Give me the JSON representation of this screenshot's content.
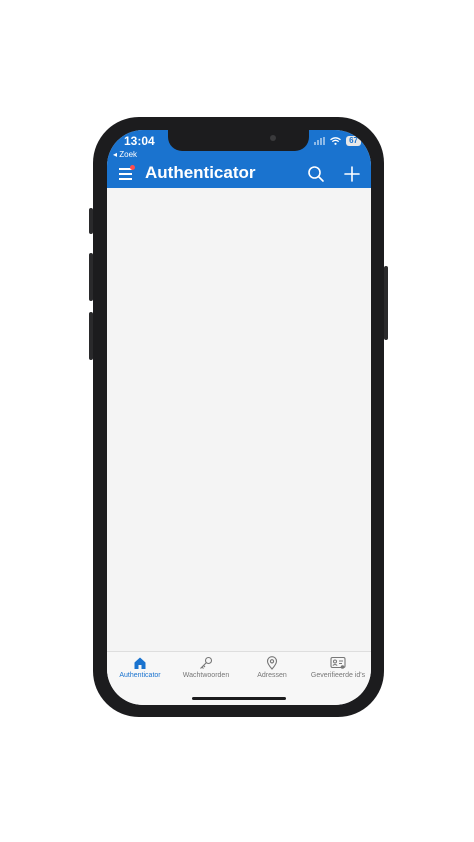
{
  "status_bar": {
    "time": "13:04",
    "back_label": "◂ Zoek",
    "battery": "67"
  },
  "app_bar": {
    "title": "Authenticator",
    "notification_dot": true
  },
  "tabs": [
    {
      "label": "Authenticator",
      "icon": "home-icon",
      "active": true
    },
    {
      "label": "Wachtwoorden",
      "icon": "key-icon",
      "active": false
    },
    {
      "label": "Adressen",
      "icon": "location-pin-icon",
      "active": false
    },
    {
      "label": "Geverifieerde id's",
      "icon": "id-card-icon",
      "active": false
    }
  ],
  "colors": {
    "accent": "#1a73cf",
    "background": "#f4f4f4",
    "inactive_tab": "#777777",
    "notification": "#ff4d4d"
  }
}
